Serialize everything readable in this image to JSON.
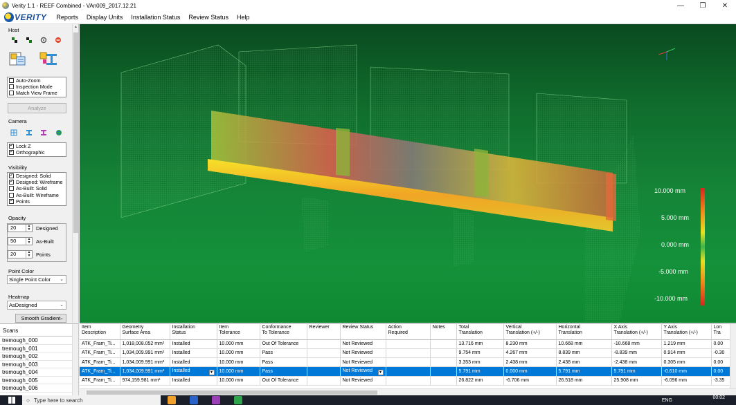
{
  "window": {
    "title": "Verity 1.1 - REEF Combined - VAn009_2017.12.21",
    "minimize": "—",
    "maximize": "❒",
    "close": "✕"
  },
  "menubar": {
    "logo": "VERITY",
    "items": [
      "Reports",
      "Display Units",
      "Installation Status",
      "Review Status",
      "Help"
    ]
  },
  "leftpanel": {
    "host_label": "Host",
    "view_options": [
      {
        "label": "Auto-Zoom",
        "checked": false
      },
      {
        "label": "Inspection Mode",
        "checked": false
      },
      {
        "label": "Match View Frame",
        "checked": false
      }
    ],
    "analyze_label": "Analyze",
    "camera_label": "Camera",
    "camera_options": [
      {
        "label": "Lock Z",
        "checked": true
      },
      {
        "label": "Orthographic",
        "checked": true
      }
    ],
    "visibility_label": "Visibility",
    "visibility_options": [
      {
        "label": "Designed: Solid",
        "checked": true
      },
      {
        "label": "Designed: Wireframe",
        "checked": true
      },
      {
        "label": "As-Built: Solid",
        "checked": false
      },
      {
        "label": "As-Built: Wireframe",
        "checked": false
      },
      {
        "label": "Points",
        "checked": true
      }
    ],
    "opacity_label": "Opacity",
    "opacity": [
      {
        "value": "20",
        "label": "Designed"
      },
      {
        "value": "50",
        "label": "As-Built"
      },
      {
        "value": "20",
        "label": "Points"
      }
    ],
    "point_color_label": "Point Color",
    "point_color_value": "Single Point Color",
    "heatmap_label": "Heatmap",
    "heatmap_value": "AsDesigned",
    "smooth_value": "Smooth Gradient"
  },
  "viewport": {
    "legend": [
      "10.000 mm",
      "5.000 mm",
      "0.000 mm",
      "-5.000 mm",
      "-10.000 mm"
    ]
  },
  "scans": {
    "header": "Scans",
    "items": [
      "tremough_000",
      "tremough_001",
      "tremough_002",
      "tremough_003",
      "tremough_004",
      "tremough_005",
      "tremough_006"
    ]
  },
  "table": {
    "columns": [
      [
        "Item",
        "Description"
      ],
      [
        "Geometry",
        "Surface Area"
      ],
      [
        "Installation",
        "Status"
      ],
      [
        "Item",
        "Tolerance"
      ],
      [
        "Conformance",
        "To Tolerance"
      ],
      [
        "Reviewer",
        ""
      ],
      [
        "Review Status",
        ""
      ],
      [
        "Action",
        "Required"
      ],
      [
        "Notes",
        ""
      ],
      [
        "Total",
        "Translation"
      ],
      [
        "Vertical",
        "Translation (+/-)"
      ],
      [
        "Horizontal",
        "Translation"
      ],
      [
        "X Axis",
        "Translation (+/-)"
      ],
      [
        "Y Axis",
        "Translation (+/-)"
      ],
      [
        "Lon",
        "Tra"
      ]
    ],
    "rows": [
      [
        "ATK_Fram_Ti...",
        "1,018,008.052 mm²",
        "Installed",
        "10.000 mm",
        "Out Of Tolerance",
        "",
        "Not Reviewed",
        "",
        "",
        "13.716 mm",
        "8.230 mm",
        "10.668 mm",
        "-10.668 mm",
        "1.219 mm",
        "0.00"
      ],
      [
        "ATK_Fram_Ti...",
        "1,034,009.991 mm²",
        "Installed",
        "10.000 mm",
        "Pass",
        "",
        "Not Reviewed",
        "",
        "",
        "9.754 mm",
        "4.267 mm",
        "8.839 mm",
        "-8.839 mm",
        "0.914 mm",
        "-0.30"
      ],
      [
        "ATK_Fram_Ti...",
        "1,034,009.991 mm²",
        "Installed",
        "10.000 mm",
        "Pass",
        "",
        "Not Reviewed",
        "",
        "",
        "3.353 mm",
        "2.438 mm",
        "2.438 mm",
        "-2.438 mm",
        "0.305 mm",
        "0.00"
      ],
      [
        "ATK_Fram_Ti...",
        "1,034,009.991 mm²",
        "Installed",
        "10.000 mm",
        "Pass",
        "",
        "Not Reviewed",
        "",
        "",
        "5.791 mm",
        "0.000 mm",
        "5.791 mm",
        "5.791 mm",
        "-0.610 mm",
        "0.00"
      ],
      [
        "ATK_Fram_Ti...",
        "974,159.981 mm²",
        "Installed",
        "10.000 mm",
        "Out Of Tolerance",
        "",
        "Not Reviewed",
        "",
        "",
        "26.822 mm",
        "-6.706 mm",
        "26.518 mm",
        "25.908 mm",
        "-6.096 mm",
        "-3.35"
      ]
    ],
    "selected_row": 3
  },
  "taskbar": {
    "search_placeholder": "Type here to search",
    "lang": "ENG",
    "time": "00:02"
  }
}
